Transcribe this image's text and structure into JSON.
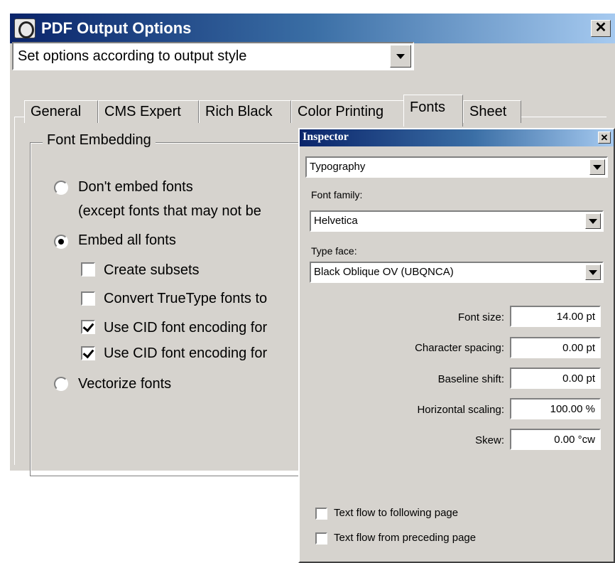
{
  "main_dialog": {
    "title": "PDF Output Options",
    "close_label": "✕",
    "output_style_select": {
      "value": "Set options according to output style"
    },
    "tabs": [
      {
        "label": "General"
      },
      {
        "label": "CMS Expert"
      },
      {
        "label": "Rich Black"
      },
      {
        "label": "Color Printing"
      },
      {
        "label": "Fonts",
        "active": true
      },
      {
        "label": "Sheet"
      }
    ],
    "font_embedding": {
      "legend": "Font Embedding",
      "options": [
        {
          "label": "Don't embed fonts",
          "type": "radio",
          "checked": false
        },
        {
          "label": "(except fonts that may not be",
          "type": "text"
        },
        {
          "label": "Embed all fonts",
          "type": "radio",
          "checked": true
        },
        {
          "label": "Create subsets",
          "type": "checkbox",
          "checked": false
        },
        {
          "label": "Convert TrueType fonts to",
          "type": "checkbox",
          "checked": false
        },
        {
          "label": "Use CID font encoding for",
          "type": "checkbox",
          "checked": true
        },
        {
          "label": "Use CID font encoding for",
          "type": "checkbox",
          "checked": true
        },
        {
          "label": "Vectorize fonts",
          "type": "radio",
          "checked": false
        }
      ]
    }
  },
  "inspector": {
    "title": "Inspector",
    "close_label": "✕",
    "category_select": {
      "value": "Typography"
    },
    "font_family": {
      "label": "Font family:",
      "value": "Helvetica"
    },
    "type_face": {
      "label": "Type face:",
      "value": "Black Oblique OV (UBQNCA)"
    },
    "fields": [
      {
        "label": "Font size:",
        "value": "14.00 pt"
      },
      {
        "label": "Character spacing:",
        "value": "0.00 pt"
      },
      {
        "label": "Baseline shift:",
        "value": "0.00 pt"
      },
      {
        "label": "Horizontal scaling:",
        "value": "100.00 %"
      },
      {
        "label": "Skew:",
        "value": "0.00 °cw"
      }
    ],
    "checkboxes": [
      {
        "label": "Text flow to following page",
        "checked": false
      },
      {
        "label": "Text flow from preceding page",
        "checked": false
      }
    ]
  }
}
